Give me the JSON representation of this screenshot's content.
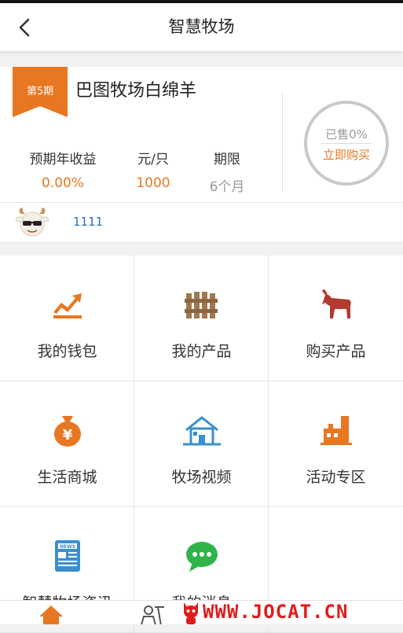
{
  "header": {
    "title": "智慧牧场"
  },
  "product": {
    "period": "第5期",
    "title": "巴图牧场白绵羊",
    "stats": {
      "yield_label": "预期年收益",
      "yield_value": "0.00%",
      "price_label": "元/只",
      "price_value": "1000",
      "term_label": "期限",
      "term_value": "6个月"
    },
    "sold_text": "已售0%",
    "sold_progress": 0,
    "buy_label": "立即购买"
  },
  "user": {
    "name": "1111"
  },
  "menu": [
    {
      "label": "我的钱包",
      "icon": "trend-up-icon"
    },
    {
      "label": "我的产品",
      "icon": "fence-icon"
    },
    {
      "label": "购买产品",
      "icon": "goat-icon"
    },
    {
      "label": "生活商城",
      "icon": "money-bag-icon"
    },
    {
      "label": "牧场视频",
      "icon": "house-icon"
    },
    {
      "label": "活动专区",
      "icon": "factory-icon"
    },
    {
      "label": "智慧牧场资讯",
      "icon": "news-icon"
    },
    {
      "label": "我的消息",
      "icon": "chat-icon"
    }
  ],
  "watermark": "WWW.JOCAT.CN",
  "colors": {
    "accent": "#e87722",
    "link": "#2d6fb5",
    "house": "#3a8fd0",
    "chat": "#2fb44a",
    "goat": "#b23a30",
    "fence": "#a07850",
    "watermark": "#e01c1c"
  }
}
